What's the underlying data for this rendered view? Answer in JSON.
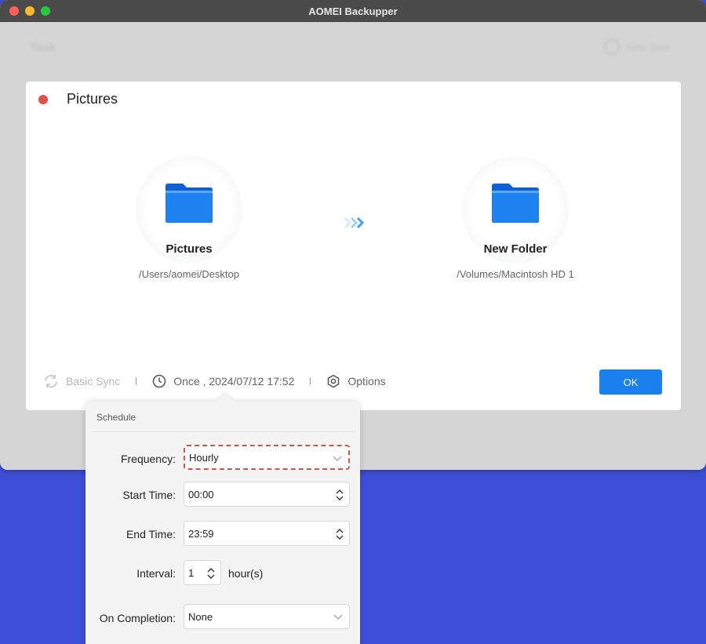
{
  "window": {
    "title": "AOMEI Backupper"
  },
  "background": {
    "page_title": "Task",
    "new_task_label": "New Task"
  },
  "task": {
    "title": "Pictures",
    "source": {
      "name": "Pictures",
      "path": "/Users/aomei/Desktop"
    },
    "destination": {
      "name": "New Folder",
      "path": "/Volumes/Macintosh HD 1"
    },
    "footer": {
      "sync_mode": "Basic Sync",
      "schedule_summary": "Once , 2024/07/12 17:52",
      "options_label": "Options"
    },
    "ok_label": "OK"
  },
  "schedule": {
    "header": "Schedule",
    "frequency": {
      "label": "Frequency:",
      "value": "Hourly"
    },
    "start_time": {
      "label": "Start Time:",
      "value": "00:00"
    },
    "end_time": {
      "label": "End Time:",
      "value": "23:59"
    },
    "interval": {
      "label": "Interval:",
      "value": "1",
      "unit": "hour(s)"
    },
    "on_completion": {
      "label": "On Completion:",
      "value": "None"
    }
  },
  "colors": {
    "accent": "#1a80ee",
    "task_status_dot": "#e0514a",
    "highlight_border": "#e0514a",
    "desktop": "#3d4fd6"
  }
}
